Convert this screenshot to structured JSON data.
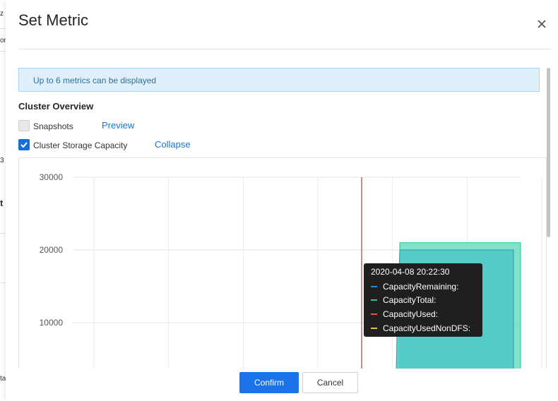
{
  "background": {
    "fragments": [
      "z",
      "or",
      "3",
      "t",
      "ta"
    ]
  },
  "dialog": {
    "title": "Set Metric",
    "info_text": "Up to 6 metrics can be displayed",
    "section_title": "Cluster Overview",
    "metrics": [
      {
        "label": "Snapshots",
        "checked": false,
        "action": "Preview"
      },
      {
        "label": "Cluster Storage Capacity",
        "checked": true,
        "action": "Collapse"
      }
    ],
    "buttons": {
      "confirm": "Confirm",
      "cancel": "Cancel"
    },
    "colors": {
      "primary": "#1a73e8",
      "info_bg": "#dff0fa",
      "checkbox_on": "#1770d9"
    }
  },
  "chart_data": {
    "type": "area",
    "y_ticks": [
      "30000",
      "20000",
      "10000"
    ],
    "ylim": [
      0,
      30000
    ],
    "grid": true,
    "series": [
      {
        "name": "CapacityRemaining",
        "color": "#1f8fd6"
      },
      {
        "name": "CapacityTotal",
        "color": "#1ec99a",
        "value": 21000
      },
      {
        "name": "CapacityUsed",
        "color": "#e8563a"
      },
      {
        "name": "CapacityUsedNonDFS",
        "color": "#f2c12e"
      }
    ],
    "area_top": 20000,
    "tooltip": {
      "time": "2020-04-08 20:22:30",
      "rows": [
        {
          "label": "CapacityRemaining:",
          "color": "#1f8fd6"
        },
        {
          "label": "CapacityTotal:",
          "color": "#1ec99a"
        },
        {
          "label": "CapacityUsed:",
          "color": "#e8563a"
        },
        {
          "label": "CapacityUsedNonDFS:",
          "color": "#f2c12e"
        }
      ]
    }
  }
}
